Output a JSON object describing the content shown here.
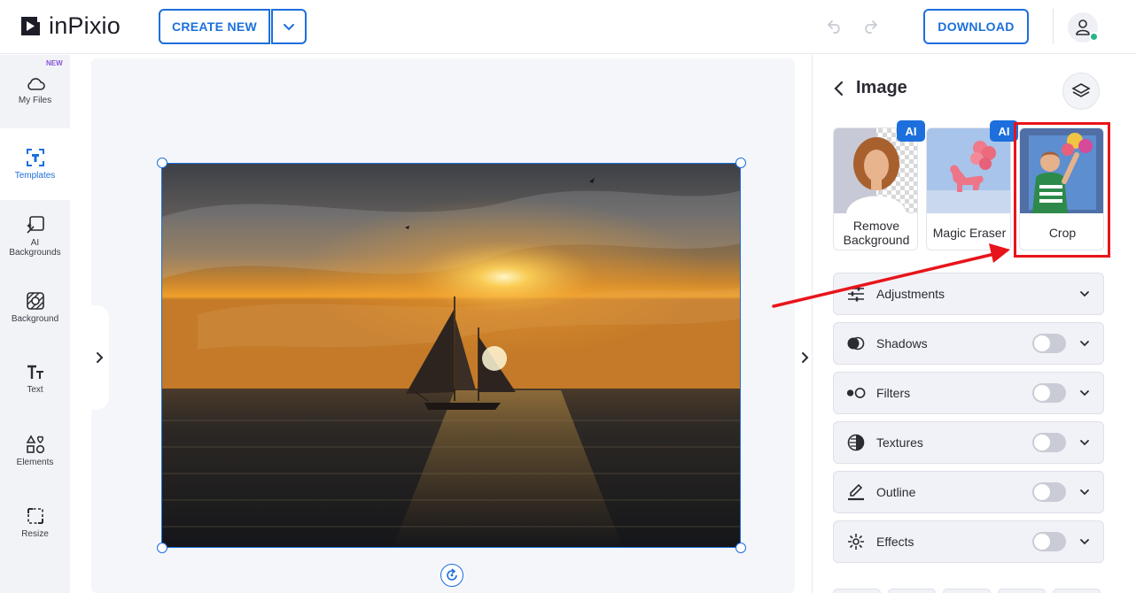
{
  "app": {
    "name": "inPixio"
  },
  "toolbar": {
    "create_label": "CREATE NEW",
    "download_label": "DOWNLOAD"
  },
  "sidebar": {
    "badge": "NEW",
    "items": [
      {
        "label": "My Files",
        "icon": "cloud-icon"
      },
      {
        "label": "Templates",
        "icon": "template-icon"
      },
      {
        "label": "AI Backgrounds",
        "icon": "ai-background-icon"
      },
      {
        "label": "Background",
        "icon": "background-pattern-icon"
      },
      {
        "label": "Text",
        "icon": "text-icon"
      },
      {
        "label": "Elements",
        "icon": "elements-icon"
      },
      {
        "label": "Resize",
        "icon": "resize-icon"
      }
    ]
  },
  "panel": {
    "title": "Image",
    "tools": [
      {
        "label": "Remove Background",
        "badge": "AI"
      },
      {
        "label": "Magic Eraser",
        "badge": "AI"
      },
      {
        "label": "Crop",
        "badge": ""
      }
    ],
    "sections": [
      {
        "label": "Adjustments",
        "icon": "sliders-icon",
        "has_toggle": false,
        "enabled": false
      },
      {
        "label": "Shadows",
        "icon": "shadows-icon",
        "has_toggle": true,
        "enabled": false
      },
      {
        "label": "Filters",
        "icon": "filters-icon",
        "has_toggle": true,
        "enabled": false
      },
      {
        "label": "Textures",
        "icon": "textures-icon",
        "has_toggle": true,
        "enabled": false
      },
      {
        "label": "Outline",
        "icon": "outline-pen-icon",
        "has_toggle": true,
        "enabled": false
      },
      {
        "label": "Effects",
        "icon": "effects-sparkle-icon",
        "has_toggle": true,
        "enabled": false
      }
    ]
  },
  "colors": {
    "accent": "#1c6fdc",
    "highlight": "#e8141b",
    "sidebar_bg": "#f2f3f7"
  }
}
